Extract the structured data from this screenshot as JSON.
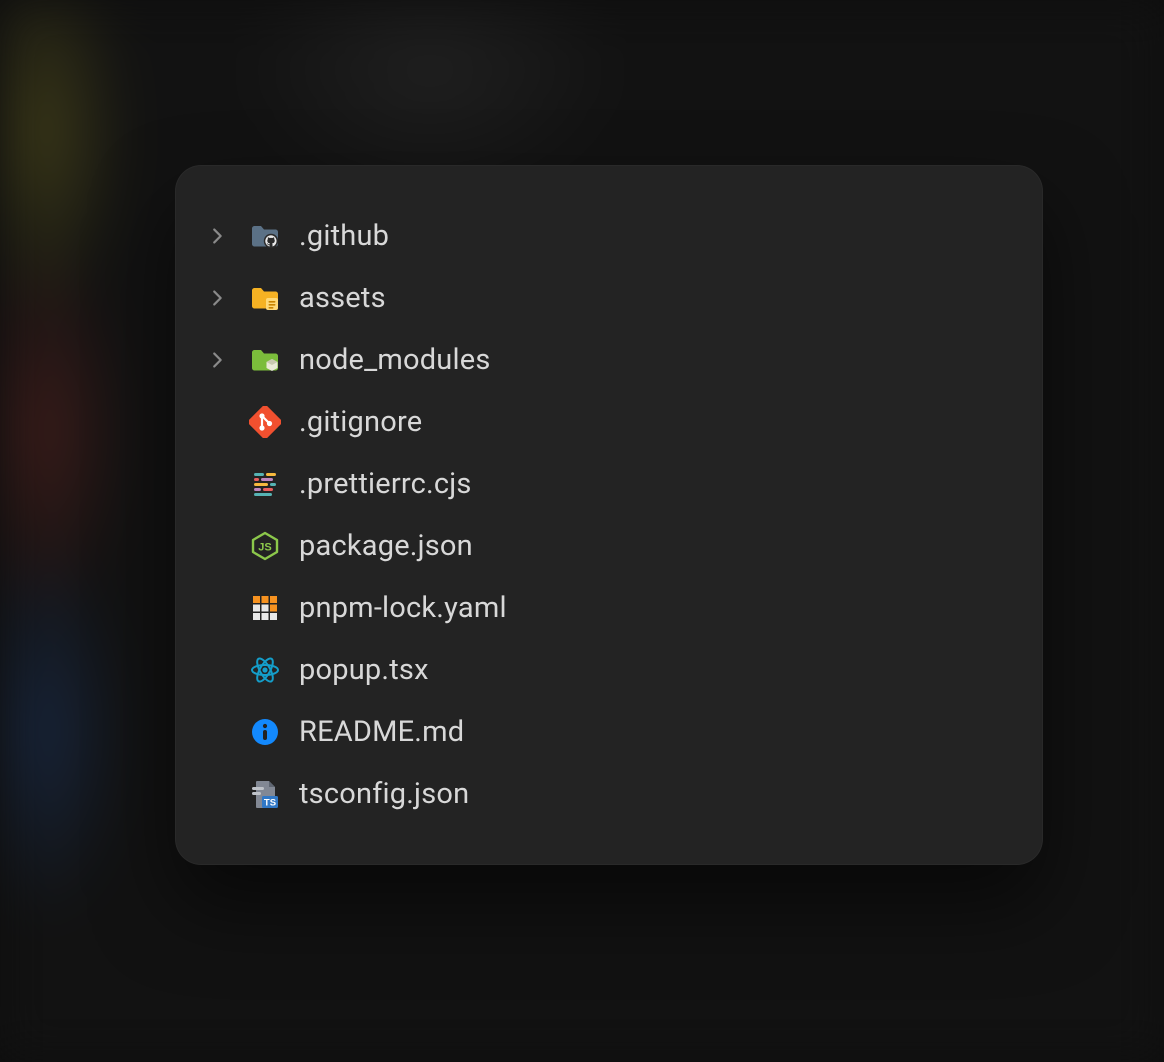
{
  "colors": {
    "panel_bg": "#232323",
    "text": "#d8d8d8",
    "chevron": "#8a8a8a",
    "github_folder": "#5b7186",
    "assets_folder": "#f6b223",
    "node_modules_folder": "#7bbd3b",
    "git": "#f1502f",
    "prettier": "#f7b93e",
    "nodejs": "#8cc84b",
    "pnpm": "#f69220",
    "react": "#149eca",
    "info": "#1389fd",
    "tsconfig": "#3178c6"
  },
  "tree": {
    "items": [
      {
        "label": ".github",
        "type": "folder",
        "expanded": false,
        "icon": "folder-github-icon"
      },
      {
        "label": "assets",
        "type": "folder",
        "expanded": false,
        "icon": "folder-assets-icon"
      },
      {
        "label": "node_modules",
        "type": "folder",
        "expanded": false,
        "icon": "folder-node-modules-icon"
      },
      {
        "label": ".gitignore",
        "type": "file",
        "icon": "git-icon"
      },
      {
        "label": ".prettierrc.cjs",
        "type": "file",
        "icon": "prettier-icon"
      },
      {
        "label": "package.json",
        "type": "file",
        "icon": "nodejs-icon"
      },
      {
        "label": "pnpm-lock.yaml",
        "type": "file",
        "icon": "pnpm-icon"
      },
      {
        "label": "popup.tsx",
        "type": "file",
        "icon": "react-icon"
      },
      {
        "label": "README.md",
        "type": "file",
        "icon": "info-icon"
      },
      {
        "label": "tsconfig.json",
        "type": "file",
        "icon": "tsconfig-icon"
      }
    ]
  }
}
